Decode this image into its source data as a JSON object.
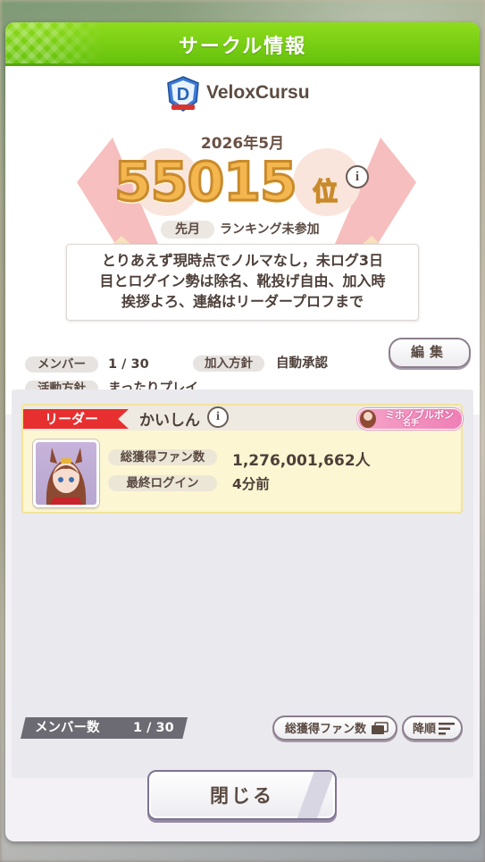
{
  "dialog": {
    "title": "サークル情報"
  },
  "circle": {
    "name": "VeloxCursu",
    "period": "2026年5月",
    "rank_number": "55015",
    "rank_suffix": "位",
    "info_symbol": "i",
    "last_month_label": "先月",
    "last_month_value": "ランキング未参加",
    "comment_lines": [
      "とりあえず現時点でノルマなし，未ログ3日",
      "目とログイン勢は除名、靴投げ自由、加入時",
      "挨拶よろ、連絡はリーダープロフまで"
    ],
    "members_label": "メンバー",
    "members_value": "1 / 30",
    "join_policy_label": "加入方針",
    "join_policy_value": "自動承認",
    "activity_policy_label": "活動方針",
    "activity_policy_value": "まったりプレイ",
    "edit_button": "編集"
  },
  "member_list": {
    "members": [
      {
        "role": "リーダー",
        "name": "かいしん",
        "title_line1": "ミホノブルボン",
        "title_line2": "名手",
        "fans_label": "総獲得ファン数",
        "fans_value": "1,276,001,662人",
        "last_login_label": "最終ログイン",
        "last_login_value": "4分前"
      }
    ],
    "count_label": "メンバー数",
    "count_value": "1 / 30",
    "sort_key_button": "総獲得ファン数",
    "sort_order_button": "降順"
  },
  "close_button": "閉じる",
  "colors": {
    "header_green": "#72c914",
    "leader_red": "#e82f2f",
    "rank_gold": "#f4b64f",
    "card_yellow": "#fdf6d2"
  }
}
